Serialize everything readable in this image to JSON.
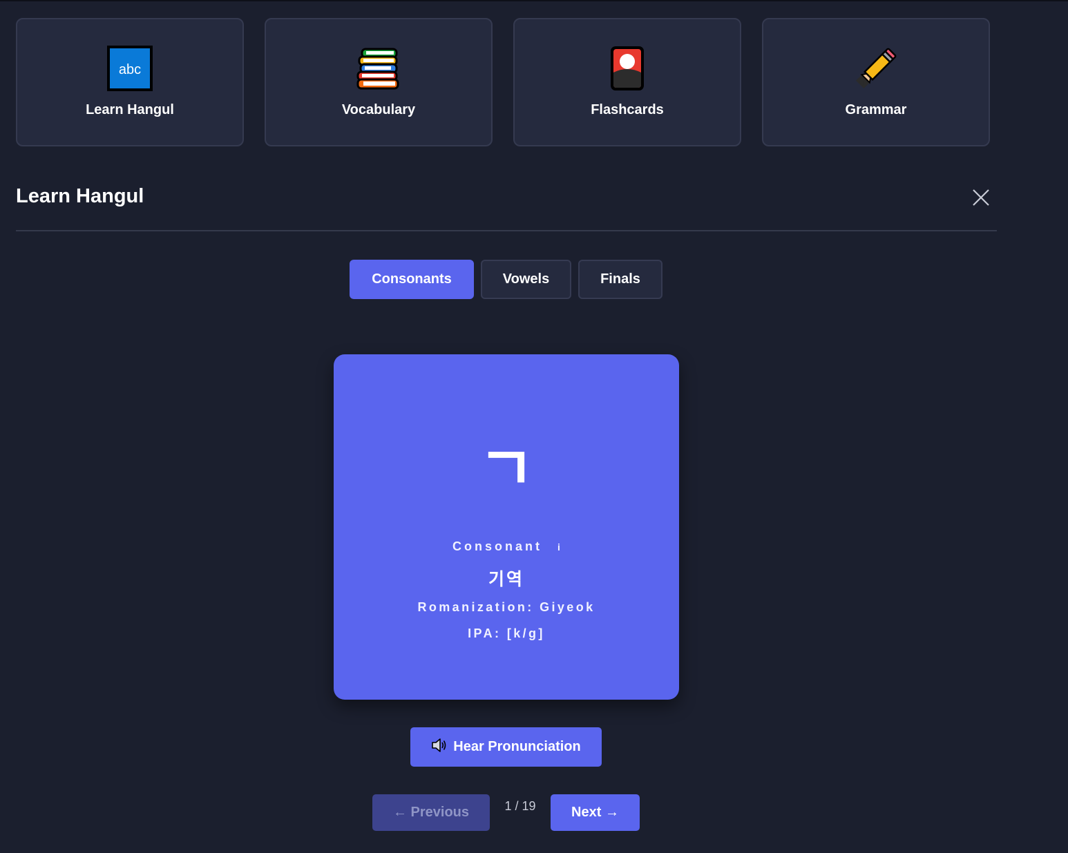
{
  "modules": [
    {
      "label": "Learn Hangul",
      "icon": "abc-icon"
    },
    {
      "label": "Vocabulary",
      "icon": "books-icon"
    },
    {
      "label": "Flashcards",
      "icon": "flashcard-icon"
    },
    {
      "label": "Grammar",
      "icon": "pencil-icon"
    }
  ],
  "section": {
    "title": "Learn Hangul",
    "close_icon": "close-icon"
  },
  "tabs": [
    {
      "label": "Consonants",
      "active": true
    },
    {
      "label": "Vowels",
      "active": false
    },
    {
      "label": "Finals",
      "active": false
    }
  ],
  "card": {
    "character": "ㄱ",
    "type": "Consonant",
    "info_glyph": "i",
    "name": "기역",
    "romanization": "Romanization: Giyeok",
    "ipa": "IPA: [k/g]"
  },
  "pronounce": {
    "label": "Hear Pronunciation",
    "icon": "speaker-icon"
  },
  "pagination": {
    "prev_label": "← Previous",
    "next_label": "Next →",
    "indicator": "1 / 19",
    "current": 1,
    "total": 19
  },
  "colors": {
    "background": "#1b1f2e",
    "card_surface": "#252a3e",
    "accent": "#5a65ee",
    "disabled_button": "#3d438e"
  }
}
